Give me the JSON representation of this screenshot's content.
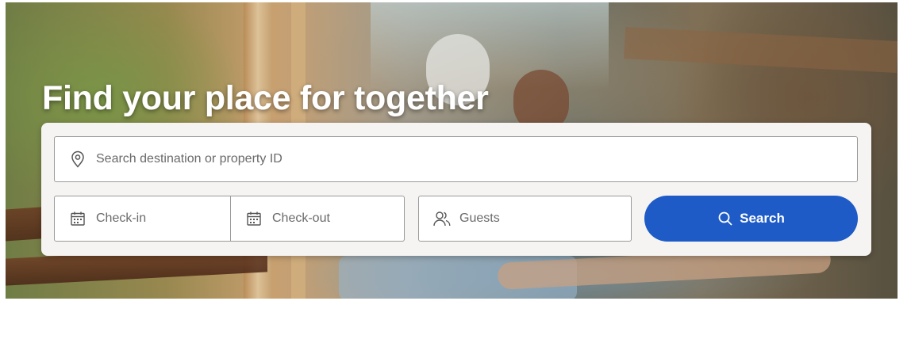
{
  "hero": {
    "headline": "Find your place for together"
  },
  "search_form": {
    "destination": {
      "placeholder": "Search destination or property ID",
      "icon": "location-pin-icon"
    },
    "check_in": {
      "placeholder": "Check-in",
      "icon": "calendar-icon"
    },
    "check_out": {
      "placeholder": "Check-out",
      "icon": "calendar-icon"
    },
    "guests": {
      "placeholder": "Guests",
      "icon": "people-icon"
    },
    "search_button": {
      "label": "Search",
      "icon": "search-icon"
    }
  },
  "colors": {
    "accent": "#1e5bc6",
    "panel_background": "#f5f4f2",
    "field_border": "#9a9a9a",
    "placeholder_text": "#6a6a6a",
    "headline_text": "#ffffff"
  }
}
